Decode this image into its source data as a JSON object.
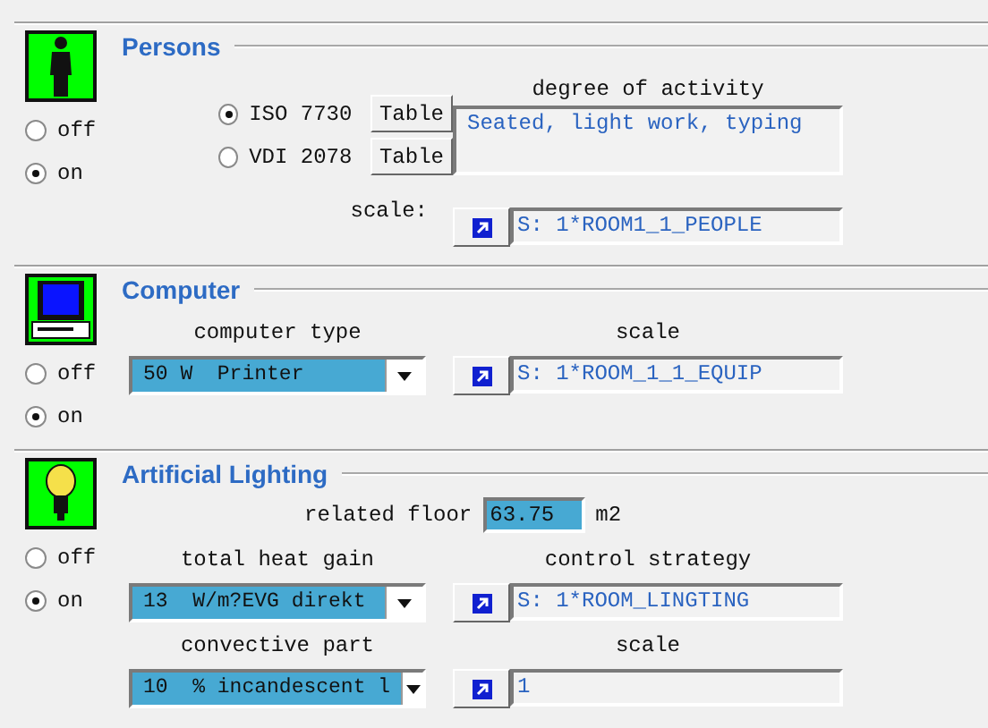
{
  "sections": [
    {
      "kind": "persons",
      "title": "Persons",
      "power": [
        {
          "label": "off",
          "selected": false
        },
        {
          "label": "on",
          "selected": true
        }
      ],
      "standards": [
        {
          "label": "ISO 7730",
          "selected": true,
          "button": "Table"
        },
        {
          "label": "VDI 2078",
          "selected": false,
          "button": "Table"
        }
      ],
      "activity": {
        "label": "degree of activity",
        "value": "Seated, light work, typing"
      },
      "scale": {
        "label": "scale:",
        "value": "S: 1*ROOM1_1_PEOPLE"
      }
    },
    {
      "kind": "computer",
      "title": "Computer",
      "power": [
        {
          "label": "off",
          "selected": false
        },
        {
          "label": "on",
          "selected": true
        }
      ],
      "type": {
        "label": "computer type",
        "value": "50 W  Printer"
      },
      "scale": {
        "label": "scale",
        "value": "S: 1*ROOM_1_1_EQUIP"
      }
    },
    {
      "kind": "lighting",
      "title": "Artificial Lighting",
      "power": [
        {
          "label": "off",
          "selected": false
        },
        {
          "label": "on",
          "selected": true
        }
      ],
      "floor": {
        "label": "related floor",
        "value": "63.75",
        "unit": "m2"
      },
      "heat_gain": {
        "label": "total heat gain",
        "value": "13  W/m?EVG direkt"
      },
      "control": {
        "label": "control strategy",
        "value": "S: 1*ROOM_LINGTING"
      },
      "convective": {
        "label": "convective part",
        "value": "10  % incandescent l"
      },
      "scale": {
        "label": "scale",
        "value": "1"
      }
    }
  ]
}
